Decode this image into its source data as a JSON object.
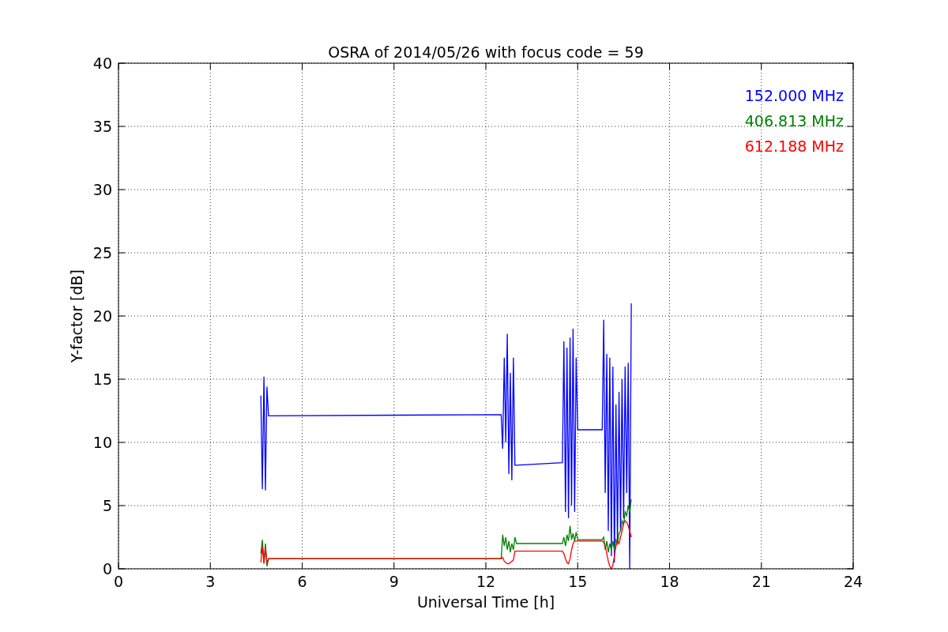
{
  "chart_data": {
    "type": "line",
    "title": "OSRA of 2014/05/26 with focus code = 59",
    "xlabel": "Universal Time [h]",
    "ylabel": "Y-factor [dB]",
    "x": [
      4.65,
      4.7,
      4.75,
      4.8,
      4.85,
      4.9,
      12.5,
      12.55,
      12.6,
      12.65,
      12.7,
      12.75,
      12.8,
      12.85,
      12.9,
      12.95,
      13.0,
      14.5,
      14.55,
      14.6,
      14.65,
      14.7,
      14.75,
      14.8,
      14.85,
      14.9,
      14.95,
      15.0,
      15.8,
      15.85,
      15.9,
      15.95,
      16.0,
      16.05,
      16.1,
      16.15,
      16.2,
      16.25,
      16.3,
      16.35,
      16.4,
      16.45,
      16.5,
      16.55,
      16.6,
      16.65,
      16.7,
      16.75
    ],
    "series": [
      {
        "name": "152.000 MHz",
        "color": "#0000ff",
        "values": [
          13.7,
          6.3,
          15.2,
          6.2,
          14.4,
          12.1,
          12.2,
          9.5,
          16.7,
          10.0,
          18.6,
          7.5,
          15.5,
          7.0,
          16.7,
          8.2,
          8.2,
          8.4,
          18.0,
          4.5,
          17.5,
          4.0,
          18.3,
          5.0,
          19.0,
          4.5,
          16.7,
          11.0,
          11.0,
          19.7,
          6.0,
          17.0,
          3.0,
          16.7,
          1.0,
          16.0,
          0.5,
          13.0,
          2.0,
          14.0,
          3.0,
          15.0,
          4.0,
          16.0,
          6.0,
          16.3,
          0,
          21.0
        ]
      },
      {
        "name": "406.813 MHz",
        "color": "#008000",
        "values": [
          1.2,
          2.3,
          0.5,
          2.0,
          0.2,
          0.8,
          0.8,
          2.7,
          1.8,
          2.5,
          1.5,
          2.2,
          1.3,
          2.0,
          1.5,
          2.5,
          2.0,
          2.0,
          2.5,
          1.8,
          2.7,
          2.2,
          3.4,
          2.3,
          2.8,
          2.2,
          2.9,
          2.3,
          2.3,
          2.5,
          1.5,
          2.2,
          1.3,
          2.0,
          1.5,
          2.2,
          1.5,
          2.3,
          2.0,
          2.8,
          3.0,
          3.8,
          3.5,
          4.5,
          4.2,
          5.0,
          4.5,
          5.5
        ]
      },
      {
        "name": "612.188 MHz",
        "color": "#ff0000",
        "values": [
          0.5,
          1.8,
          0.4,
          1.7,
          0.5,
          0.8,
          0.8,
          0.9,
          0.6,
          0.5,
          0.4,
          0.4,
          0.5,
          0.6,
          0.7,
          1.4,
          1.4,
          1.4,
          1.2,
          0.8,
          0.5,
          0.4,
          0.8,
          1.5,
          2.0,
          2.2,
          2.2,
          2.2,
          2.2,
          2.1,
          1.8,
          1.2,
          0.6,
          0.2,
          0.0,
          0.3,
          1.0,
          1.8,
          2.2,
          2.0,
          2.5,
          3.0,
          3.6,
          3.8,
          3.7,
          3.4,
          3.0,
          2.5
        ]
      }
    ],
    "grid": true,
    "xlim": [
      0,
      24
    ],
    "ylim": [
      0,
      40
    ],
    "xticks": [
      0,
      3,
      6,
      9,
      12,
      15,
      18,
      21,
      24
    ],
    "yticks": [
      0,
      5,
      10,
      15,
      20,
      25,
      30,
      35,
      40
    ]
  }
}
